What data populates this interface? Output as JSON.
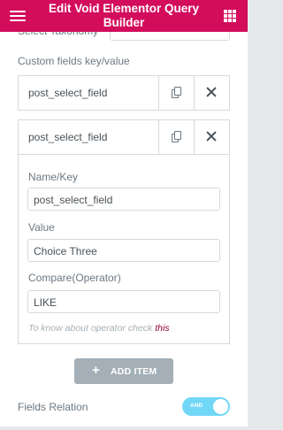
{
  "header": {
    "title": "Edit Void Elementor Query Builder",
    "menu_icon": "hamburger-icon",
    "apps_icon": "apps-grid-icon",
    "color": "#d30c5c"
  },
  "taxonomy": {
    "label": "Select Taxonomy"
  },
  "custom_fields": {
    "label": "Custom fields key/value",
    "items": [
      {
        "title": "post_select_field"
      },
      {
        "title": "post_select_field"
      }
    ],
    "expanded": {
      "name_label": "Name/Key",
      "name_value": "post_select_field",
      "value_label": "Value",
      "value_value": "Choice Three",
      "compare_label": "Compare(Operator)",
      "compare_value": "LIKE",
      "note_text": "To know about operator check",
      "note_link": "this"
    }
  },
  "add_item": {
    "label": "ADD ITEM",
    "icon": "plus-icon"
  },
  "relation": {
    "label": "Fields Relation",
    "toggle_text": "AND",
    "toggle_on": true,
    "toggle_color": "#71d7f7"
  }
}
